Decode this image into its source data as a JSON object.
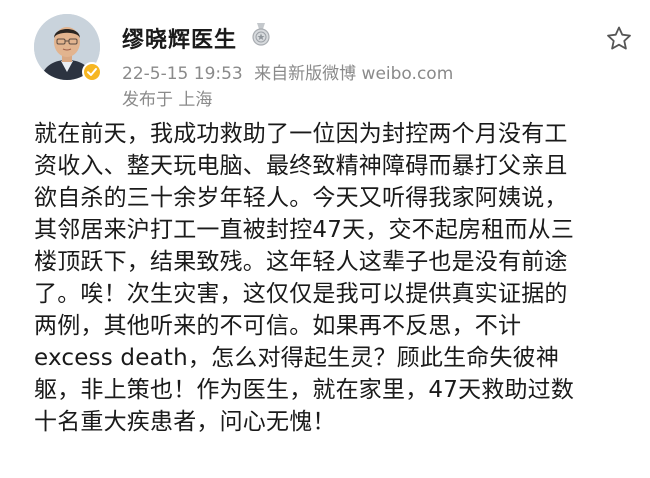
{
  "post": {
    "author": {
      "name": "缪晓辉医生",
      "verified": true,
      "verified_color": "#f6b622"
    },
    "meta": {
      "timestamp": "22-5-15 19:53",
      "source": "来自新版微博 weibo.com",
      "location": "发布于 上海"
    },
    "actions": {
      "favorite_icon": "star-outline-icon"
    },
    "body_lines": [
      "就在前天，我成功救助了一位因为封控两个月没有工",
      "资收入、整天玩电脑、最终致精神障碍而暴打父亲且",
      "欲自杀的三十余岁年轻人。今天又听得我家阿姨说，",
      "其邻居来沪打工一直被封控47天，交不起房租而从三",
      "楼顶跃下，结果致残。这年轻人这辈子也是没有前途",
      "了。唉！次生灾害，这仅仅是我可以提供真实证据的",
      "两例，其他听来的不可信。如果再不反思，不计",
      "excess death，怎么对得起生灵？顾此生命失彼神",
      "躯，非上策也！作为医生，就在家里，47天救助过数",
      "十名重大疾患者，问心无愧！"
    ]
  }
}
